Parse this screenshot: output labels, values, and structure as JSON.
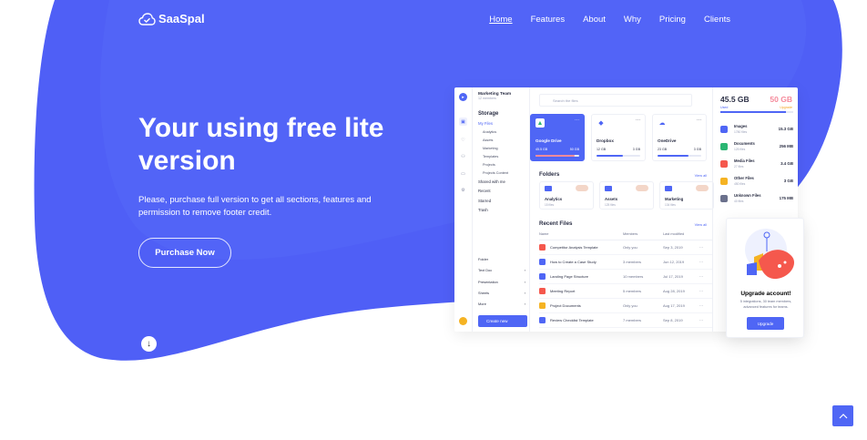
{
  "nav": {
    "brand": "SaaSpal",
    "links": [
      "Home",
      "Features",
      "About",
      "Why",
      "Pricing",
      "Clients"
    ]
  },
  "hero": {
    "title": "Your using free lite version",
    "subtitle": "Please, purchase full version to get all sections, features and permission to remove footer credit.",
    "cta": "Purchase Now"
  },
  "colors": {
    "brand": "#4f66f5",
    "blob": "#5563f7"
  },
  "icons": {
    "scroll": "arrow-down-icon",
    "top": "chevron-up-icon",
    "logo": "cloud-check-icon"
  },
  "mock": {
    "team": "Marketing Team",
    "team_sub": "12 members",
    "search_placeholder": "Search the files",
    "storage_heading": "Storage",
    "sidebar": {
      "my_files": "My Files",
      "subs": [
        "Analytics",
        "Assets",
        "Marketing",
        "Templates",
        "Projects",
        "Projects Content"
      ],
      "items": [
        "Shared with me",
        "Recent",
        "Starred",
        "Trash"
      ]
    },
    "new_menu": [
      "Folder",
      "Text Doc",
      "Presentation",
      "Sheets",
      "More"
    ],
    "create_label": "Create new",
    "cards": [
      {
        "name": "Google Drive",
        "size": "45.5 GB",
        "cap": "50 GB",
        "fill": 0.9
      },
      {
        "name": "Dropbox",
        "size": "12 GB",
        "cap": "3 GB",
        "fill": 0.6
      },
      {
        "name": "OneDrive",
        "size": "23 GB",
        "cap": "3 GB",
        "fill": 0.7
      }
    ],
    "folders_heading": "Folders",
    "view_all": "View all",
    "folders": [
      {
        "name": "Analytics",
        "count": "15 files"
      },
      {
        "name": "Assets",
        "count": "125 files"
      },
      {
        "name": "Marketing",
        "count": "134 files"
      }
    ],
    "recent_heading": "Recent Files",
    "recent_cols": [
      "Name",
      "Members",
      "Last modified"
    ],
    "recent": [
      {
        "name": "Competitor Analysis Template",
        "members": "Only you",
        "date": "Sep 3, 2019",
        "color": "#f5584d"
      },
      {
        "name": "How to Create a Case Study",
        "members": "3 members",
        "date": "Jun 12, 2019",
        "color": "#4f66f5"
      },
      {
        "name": "Landing Page Structure",
        "members": "10 members",
        "date": "Jul 17, 2019",
        "color": "#4f66f5"
      },
      {
        "name": "Meeting Report",
        "members": "5 members",
        "date": "Aug 28, 2019",
        "color": "#f5584d"
      },
      {
        "name": "Project Documents",
        "members": "Only you",
        "date": "Aug 17, 2019",
        "color": "#f5b323"
      },
      {
        "name": "Review Checklist Template",
        "members": "7 members",
        "date": "Sep 8, 2019",
        "color": "#4f66f5"
      }
    ],
    "storage": {
      "used": "45.5 GB",
      "total": "50 GB",
      "used_label": "Used",
      "upgrade_label": "Upgrade",
      "fill": 0.9,
      "categories": [
        {
          "name": "Images",
          "count": "1780 files",
          "size": "15.3 GB",
          "color": "#4f66f5"
        },
        {
          "name": "Documents",
          "count": "125 files",
          "size": "256 MB",
          "color": "#2bb673"
        },
        {
          "name": "Media Files",
          "count": "27 files",
          "size": "3.4 GB",
          "color": "#f5584d"
        },
        {
          "name": "Other Files",
          "count": "450 files",
          "size": "3 GB",
          "color": "#f5b323"
        },
        {
          "name": "Unknown Files",
          "count": "40 files",
          "size": "175 MB",
          "color": "#6b718c"
        }
      ]
    },
    "promo": {
      "title": "Upgrade account!",
      "desc": "5 integrations, 30 team members, advanced features for teams.",
      "button": "Upgrade"
    }
  }
}
